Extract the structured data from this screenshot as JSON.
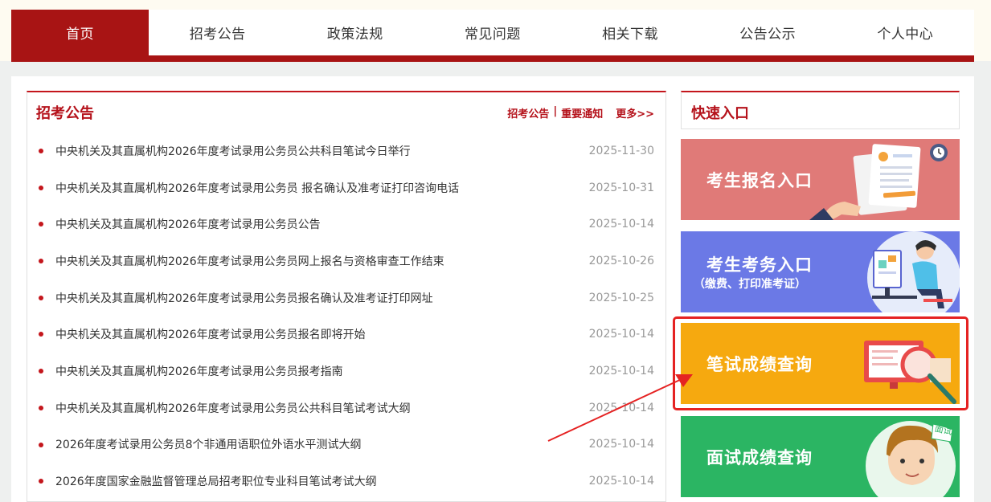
{
  "nav": {
    "items": [
      "首页",
      "招考公告",
      "政策法规",
      "常见问题",
      "相关下载",
      "公告公示",
      "个人中心"
    ]
  },
  "notice": {
    "title": "招考公告",
    "link1": "招考公告",
    "sep": "|",
    "link2": "重要通知",
    "more": "更多>>",
    "items": [
      {
        "title": "中央机关及其直属机构2026年度考试录用公务员公共科目笔试今日举行",
        "date": "2025-11-30"
      },
      {
        "title": "中央机关及其直属机构2026年度考试录用公务员 报名确认及准考证打印咨询电话",
        "date": "2025-10-31"
      },
      {
        "title": "中央机关及其直属机构2026年度考试录用公务员公告",
        "date": "2025-10-14"
      },
      {
        "title": "中央机关及其直属机构2026年度考试录用公务员网上报名与资格审查工作结束",
        "date": "2025-10-26"
      },
      {
        "title": "中央机关及其直属机构2026年度考试录用公务员报名确认及准考证打印网址",
        "date": "2025-10-25"
      },
      {
        "title": "中央机关及其直属机构2026年度考试录用公务员报名即将开始",
        "date": "2025-10-14"
      },
      {
        "title": "中央机关及其直属机构2026年度考试录用公务员报考指南",
        "date": "2025-10-14"
      },
      {
        "title": "中央机关及其直属机构2026年度考试录用公务员公共科目笔试考试大纲",
        "date": "2025-10-14"
      },
      {
        "title": "2026年度考试录用公务员8个非通用语职位外语水平测试大纲",
        "date": "2025-10-14"
      },
      {
        "title": "2026年度国家金融监督管理总局招考职位专业科目笔试考试大纲",
        "date": "2025-10-14"
      }
    ]
  },
  "quick": {
    "title": "快速入口",
    "cards": [
      {
        "label": "考生报名入口",
        "color": "#e07a78"
      },
      {
        "label": "考生考务入口",
        "sub": "（缴费、打印准考证）",
        "color": "#6b79e6"
      },
      {
        "label": "笔试成绩查询",
        "color": "#f6a90f"
      },
      {
        "label": "面试成绩查询",
        "color": "#2bb563"
      }
    ],
    "interview_stamp": "面试"
  },
  "colors": {
    "brand_red": "#a81414",
    "highlight": "#e52222"
  }
}
